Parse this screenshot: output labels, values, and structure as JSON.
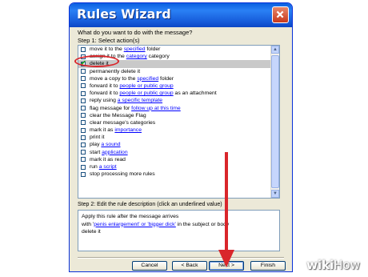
{
  "window": {
    "title": "Rules Wizard",
    "question": "What do you want to do with the message?",
    "step1_label": "Step 1: Select action(s)",
    "step2_label": "Step 2: Edit the rule description (click an underlined value)"
  },
  "actions": [
    {
      "checked": false,
      "pre": "move it to the ",
      "link": "specified",
      "post": " folder"
    },
    {
      "checked": false,
      "pre": "assign it to the ",
      "link": "category",
      "post": " category"
    },
    {
      "checked": true,
      "pre": "delete it",
      "link": "",
      "post": ""
    },
    {
      "checked": false,
      "pre": "permanently delete it",
      "link": "",
      "post": ""
    },
    {
      "checked": false,
      "pre": "move a copy to the ",
      "link": "specified",
      "post": " folder"
    },
    {
      "checked": false,
      "pre": "forward it to ",
      "link": "people or public group",
      "post": ""
    },
    {
      "checked": false,
      "pre": "forward it to ",
      "link": "people or public group",
      "post": " as an attachment"
    },
    {
      "checked": false,
      "pre": "reply using ",
      "link": "a specific template",
      "post": ""
    },
    {
      "checked": false,
      "pre": "flag message for ",
      "link": "follow up at this time",
      "post": ""
    },
    {
      "checked": false,
      "pre": "clear the Message Flag",
      "link": "",
      "post": ""
    },
    {
      "checked": false,
      "pre": "clear message's categories",
      "link": "",
      "post": ""
    },
    {
      "checked": false,
      "pre": "mark it as ",
      "link": "importance",
      "post": ""
    },
    {
      "checked": false,
      "pre": "print it",
      "link": "",
      "post": ""
    },
    {
      "checked": false,
      "pre": "play ",
      "link": "a sound",
      "post": ""
    },
    {
      "checked": false,
      "pre": "start ",
      "link": "application",
      "post": ""
    },
    {
      "checked": false,
      "pre": "mark it as read",
      "link": "",
      "post": ""
    },
    {
      "checked": false,
      "pre": "run ",
      "link": "a script",
      "post": ""
    },
    {
      "checked": false,
      "pre": "stop processing more rules",
      "link": "",
      "post": ""
    }
  ],
  "description": {
    "line1": "Apply this rule after the message arrives",
    "line2_pre": "with '",
    "line2_link": "penis enlargement' or 'bigger dick'",
    "line2_post": " in the subject or body",
    "line3": "delete it"
  },
  "buttons": {
    "cancel": "Cancel",
    "back": "< Back",
    "next": "Next >",
    "finish": "Finish"
  },
  "watermark": {
    "wiki": "wiki",
    "how": "How"
  },
  "colors": {
    "annotation": "#d9262b",
    "titlebar": "#1559d8",
    "link": "#0000ff"
  }
}
